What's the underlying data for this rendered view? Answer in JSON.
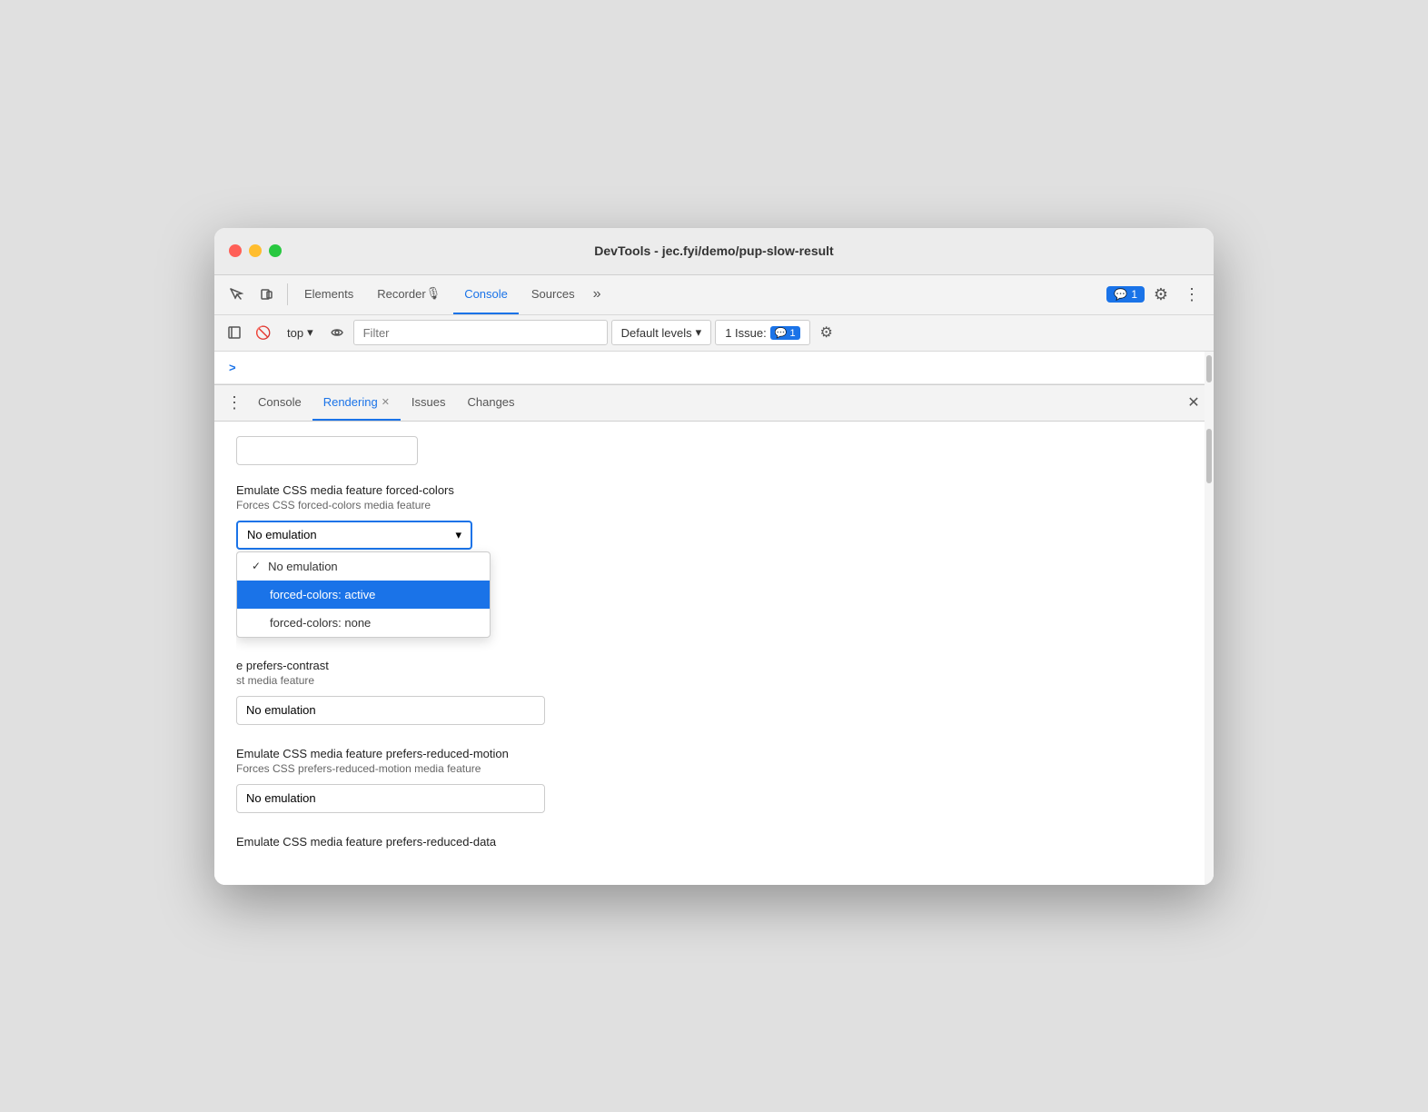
{
  "window": {
    "title": "DevTools - jec.fyi/demo/pup-slow-result"
  },
  "nav": {
    "tabs": [
      {
        "id": "elements",
        "label": "Elements",
        "active": false
      },
      {
        "id": "recorder",
        "label": "Recorder",
        "active": false
      },
      {
        "id": "console",
        "label": "Console",
        "active": true
      },
      {
        "id": "sources",
        "label": "Sources",
        "active": false
      }
    ],
    "more_label": "»",
    "badge_count": "1",
    "badge_icon": "💬"
  },
  "toolbar": {
    "top_label": "top",
    "filter_placeholder": "Filter",
    "default_levels_label": "Default levels",
    "issue_label": "1 Issue:",
    "issue_count": "1"
  },
  "console_prompt": ">",
  "drawer": {
    "tabs": [
      {
        "id": "console",
        "label": "Console",
        "active": false,
        "closeable": false
      },
      {
        "id": "rendering",
        "label": "Rendering",
        "active": true,
        "closeable": true
      },
      {
        "id": "issues",
        "label": "Issues",
        "active": false,
        "closeable": false
      },
      {
        "id": "changes",
        "label": "Changes",
        "active": false,
        "closeable": false
      }
    ],
    "close_label": "✕"
  },
  "rendering": {
    "forced_colors": {
      "title": "Emulate CSS media feature forced-colors",
      "desc": "Forces CSS forced-colors media feature",
      "dropdown_value": "No emulation",
      "dropdown_options": [
        {
          "id": "no-emulation",
          "label": "No emulation",
          "checked": true,
          "selected": false
        },
        {
          "id": "forced-active",
          "label": "forced-colors: active",
          "checked": false,
          "selected": true
        },
        {
          "id": "forced-none",
          "label": "forced-colors: none",
          "checked": false,
          "selected": false
        }
      ]
    },
    "prefers_contrast": {
      "title_partial": "e prefers-contrast",
      "desc_partial": "st media feature",
      "dropdown_value": "No emulation"
    },
    "prefers_reduced_motion": {
      "title": "Emulate CSS media feature prefers-reduced-motion",
      "desc": "Forces CSS prefers-reduced-motion media feature",
      "dropdown_value": "No emulation"
    },
    "bottom_partial_title": "Emulate CSS media feature prefers-reduced-data"
  }
}
